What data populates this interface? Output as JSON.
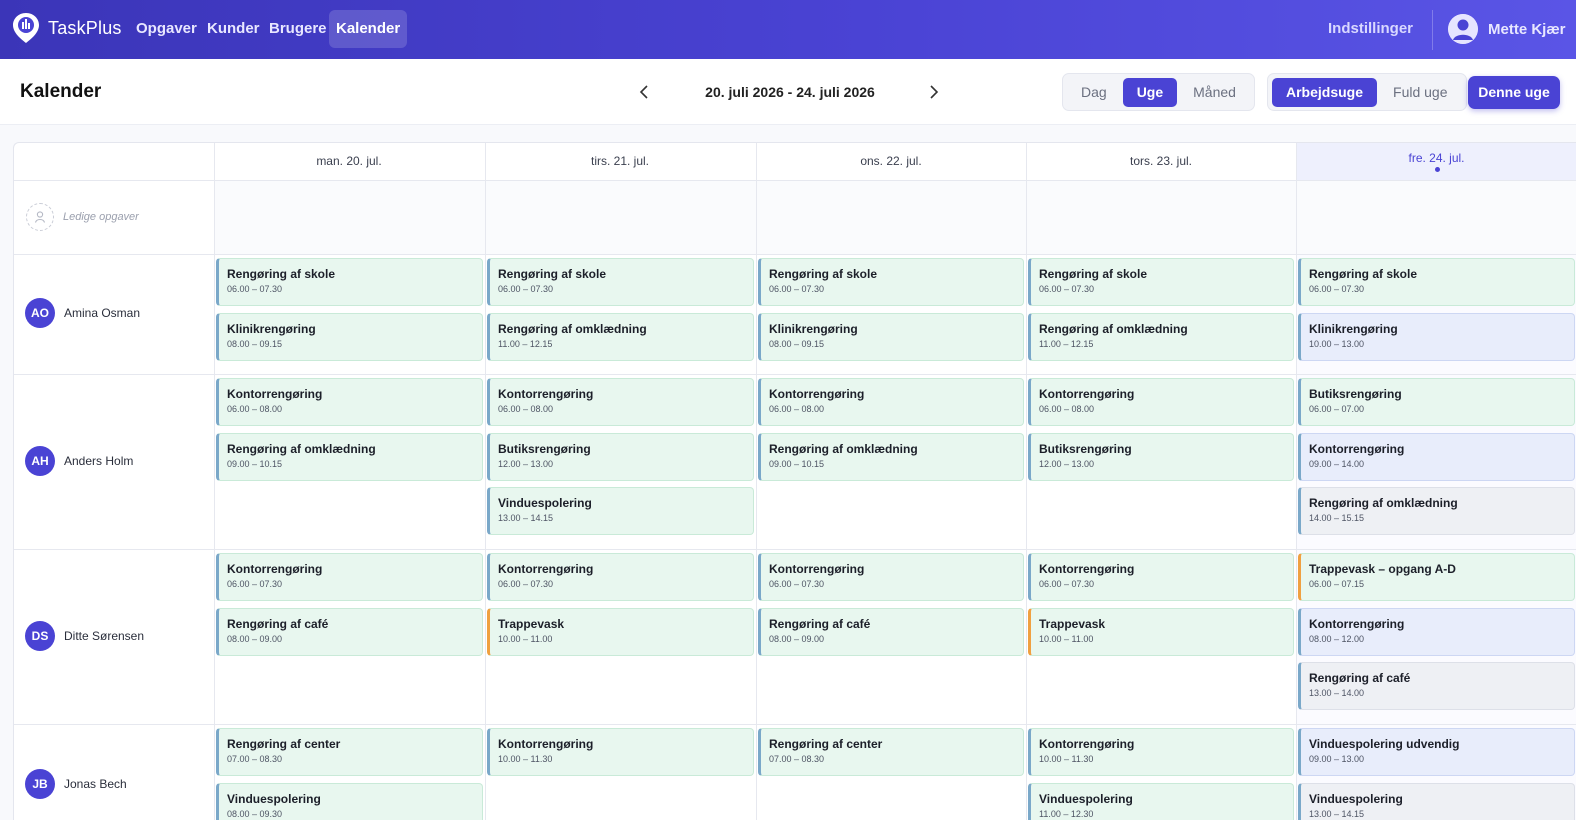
{
  "app": {
    "name": "TaskPlus"
  },
  "nav": {
    "items": [
      {
        "label": "Opgaver",
        "active": false
      },
      {
        "label": "Kunder",
        "active": false
      },
      {
        "label": "Brugere",
        "active": false
      },
      {
        "label": "Kalender",
        "active": true
      }
    ],
    "settings_label": "Indstillinger",
    "user_name": "Mette Kjær"
  },
  "toolbar": {
    "title": "Kalender",
    "date_range": "20. juli 2026 - 24. juli 2026",
    "view_options": [
      {
        "label": "Dag",
        "active": false
      },
      {
        "label": "Uge",
        "active": true
      },
      {
        "label": "Måned",
        "active": false
      }
    ],
    "week_options": [
      {
        "label": "Arbejdsuge",
        "active": true
      },
      {
        "label": "Fuld uge",
        "active": false
      }
    ],
    "this_week_label": "Denne uge"
  },
  "calendar": {
    "days": [
      {
        "label": "man. 20. jul.",
        "today": false
      },
      {
        "label": "tirs. 21. jul.",
        "today": false
      },
      {
        "label": "ons. 22. jul.",
        "today": false
      },
      {
        "label": "tors. 23. jul.",
        "today": false
      },
      {
        "label": "fre. 24. jul.",
        "today": true
      }
    ],
    "unassigned_label": "Ledige opgaver",
    "employees": [
      {
        "initials": "AO",
        "name": "Amina Osman",
        "days": [
          [
            {
              "title": "Rengøring af skole",
              "time": "06.00 – 07.30",
              "style": "green"
            },
            {
              "title": "Klinikrengøring",
              "time": "08.00 – 09.15",
              "style": "green"
            }
          ],
          [
            {
              "title": "Rengøring af skole",
              "time": "06.00 – 07.30",
              "style": "green"
            },
            {
              "title": "Rengøring af omklædning",
              "time": "11.00 – 12.15",
              "style": "green"
            }
          ],
          [
            {
              "title": "Rengøring af skole",
              "time": "06.00 – 07.30",
              "style": "green"
            },
            {
              "title": "Klinikrengøring",
              "time": "08.00 – 09.15",
              "style": "green"
            }
          ],
          [
            {
              "title": "Rengøring af skole",
              "time": "06.00 – 07.30",
              "style": "green"
            },
            {
              "title": "Rengøring af omklædning",
              "time": "11.00 – 12.15",
              "style": "green"
            }
          ],
          [
            {
              "title": "Rengøring af skole",
              "time": "06.00 – 07.30",
              "style": "green"
            },
            {
              "title": "Klinikrengøring",
              "time": "10.00 – 13.00",
              "style": "blue"
            }
          ]
        ]
      },
      {
        "initials": "AH",
        "name": "Anders Holm",
        "days": [
          [
            {
              "title": "Kontorrengøring",
              "time": "06.00 – 08.00",
              "style": "green"
            },
            {
              "title": "Rengøring af omklædning",
              "time": "09.00 – 10.15",
              "style": "green"
            }
          ],
          [
            {
              "title": "Kontorrengøring",
              "time": "06.00 – 08.00",
              "style": "green"
            },
            {
              "title": "Butiksrengøring",
              "time": "12.00 – 13.00",
              "style": "green"
            },
            {
              "title": "Vinduespolering",
              "time": "13.00 – 14.15",
              "style": "green"
            }
          ],
          [
            {
              "title": "Kontorrengøring",
              "time": "06.00 – 08.00",
              "style": "green"
            },
            {
              "title": "Rengøring af omklædning",
              "time": "09.00 – 10.15",
              "style": "green"
            }
          ],
          [
            {
              "title": "Kontorrengøring",
              "time": "06.00 – 08.00",
              "style": "green"
            },
            {
              "title": "Butiksrengøring",
              "time": "12.00 – 13.00",
              "style": "green"
            }
          ],
          [
            {
              "title": "Butiksrengøring",
              "time": "06.00 – 07.00",
              "style": "green"
            },
            {
              "title": "Kontorrengøring",
              "time": "09.00 – 14.00",
              "style": "blue"
            },
            {
              "title": "Rengøring af omklædning",
              "time": "14.00 – 15.15",
              "style": "gray"
            }
          ]
        ]
      },
      {
        "initials": "DS",
        "name": "Ditte Sørensen",
        "days": [
          [
            {
              "title": "Kontorrengøring",
              "time": "06.00 – 07.30",
              "style": "green"
            },
            {
              "title": "Rengøring af café",
              "time": "08.00 – 09.00",
              "style": "green"
            }
          ],
          [
            {
              "title": "Kontorrengøring",
              "time": "06.00 – 07.30",
              "style": "green"
            },
            {
              "title": "Trappevask",
              "time": "10.00 – 11.00",
              "style": "orange"
            }
          ],
          [
            {
              "title": "Kontorrengøring",
              "time": "06.00 – 07.30",
              "style": "green"
            },
            {
              "title": "Rengøring af café",
              "time": "08.00 – 09.00",
              "style": "green"
            }
          ],
          [
            {
              "title": "Kontorrengøring",
              "time": "06.00 – 07.30",
              "style": "green"
            },
            {
              "title": "Trappevask",
              "time": "10.00 – 11.00",
              "style": "orange"
            }
          ],
          [
            {
              "title": "Trappevask – opgang A-D",
              "time": "06.00 – 07.15",
              "style": "orange"
            },
            {
              "title": "Kontorrengøring",
              "time": "08.00 – 12.00",
              "style": "blue"
            },
            {
              "title": "Rengøring af café",
              "time": "13.00 – 14.00",
              "style": "gray"
            }
          ]
        ]
      },
      {
        "initials": "JB",
        "name": "Jonas Bech",
        "days": [
          [
            {
              "title": "Rengøring af center",
              "time": "07.00 – 08.30",
              "style": "green"
            },
            {
              "title": "Vinduespolering",
              "time": "08.00 – 09.30",
              "style": "green"
            }
          ],
          [
            {
              "title": "Kontorrengøring",
              "time": "10.00 – 11.30",
              "style": "green"
            }
          ],
          [
            {
              "title": "Rengøring af center",
              "time": "07.00 – 08.30",
              "style": "green"
            }
          ],
          [
            {
              "title": "Kontorrengøring",
              "time": "10.00 – 11.30",
              "style": "green"
            },
            {
              "title": "Vinduespolering",
              "time": "11.00 – 12.30",
              "style": "green"
            }
          ],
          [
            {
              "title": "Vinduespolering udvendig",
              "time": "09.00 – 13.00",
              "style": "blue"
            },
            {
              "title": "Vinduespolering",
              "time": "13.00 – 14.15",
              "style": "gray"
            }
          ]
        ]
      }
    ]
  },
  "colors": {
    "accent": "#4a43d4",
    "task_green": "#e8f7ef",
    "task_blue": "#e8edfb",
    "task_gray": "#eef0f4",
    "task_orange_border": "#f0a040"
  }
}
